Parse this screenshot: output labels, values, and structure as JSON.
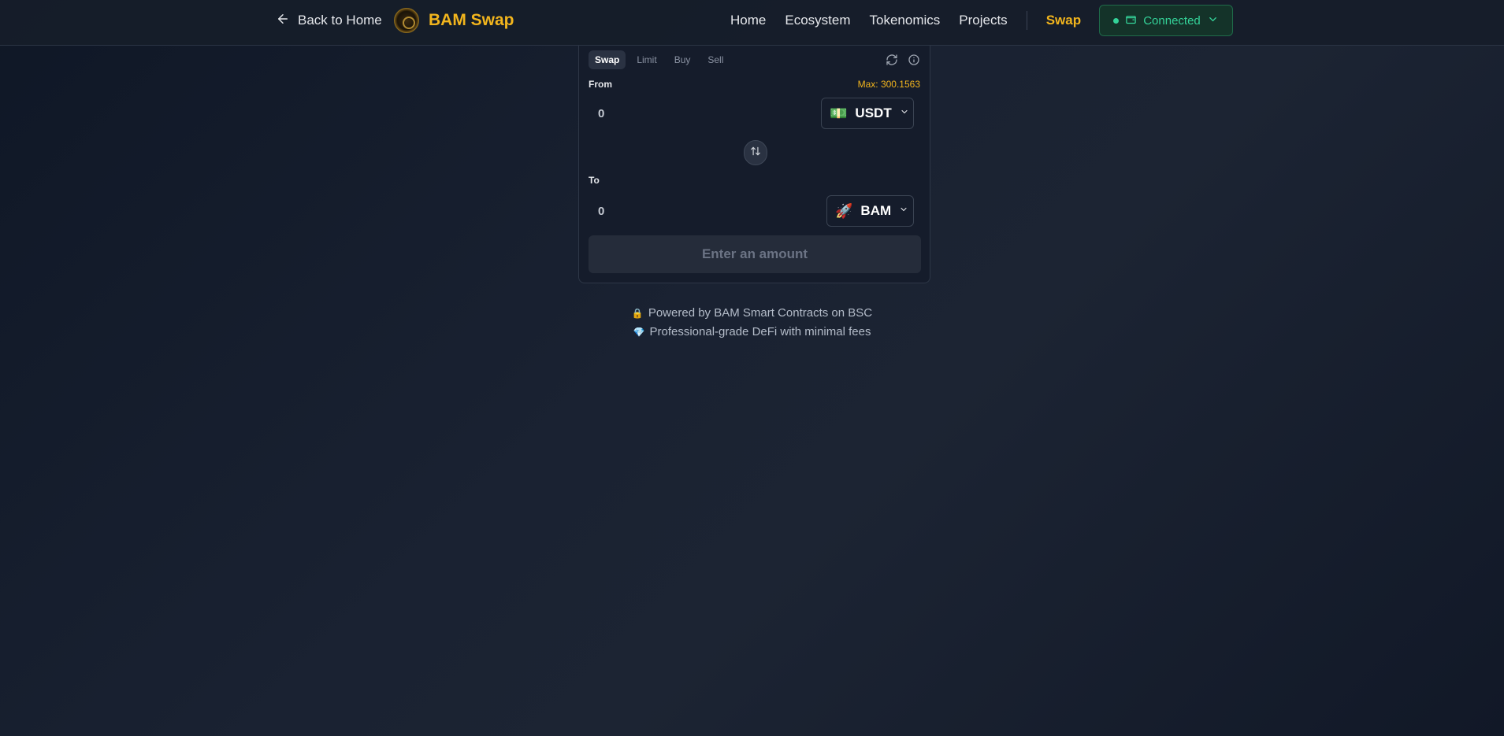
{
  "header": {
    "back_label": "Back to Home",
    "brand_name": "BAM Swap",
    "nav": [
      "Home",
      "Ecosystem",
      "Tokenomics",
      "Projects"
    ],
    "active_nav": "Swap",
    "wallet": {
      "status": "Connected",
      "status_color": "#34d399"
    }
  },
  "swap": {
    "tabs": [
      "Swap",
      "Limit",
      "Buy",
      "Sell"
    ],
    "active_tab": "Swap",
    "from_label": "From",
    "max_label": "Max: 300.1563",
    "from_value": "0",
    "from_token": {
      "symbol": "USDT",
      "icon": "💵"
    },
    "to_label": "To",
    "to_value": "0",
    "to_token": {
      "symbol": "BAM",
      "icon": "🚀"
    },
    "submit_label": "Enter an amount"
  },
  "notes": [
    {
      "icon": "🔒",
      "text": "Powered by BAM Smart Contracts on BSC"
    },
    {
      "icon": "💎",
      "text": "Professional-grade DeFi with minimal fees"
    }
  ],
  "colors": {
    "accent": "#f2b51d",
    "background": "#1a2232",
    "card": "#151c2b",
    "connected_green": "#34d399"
  }
}
